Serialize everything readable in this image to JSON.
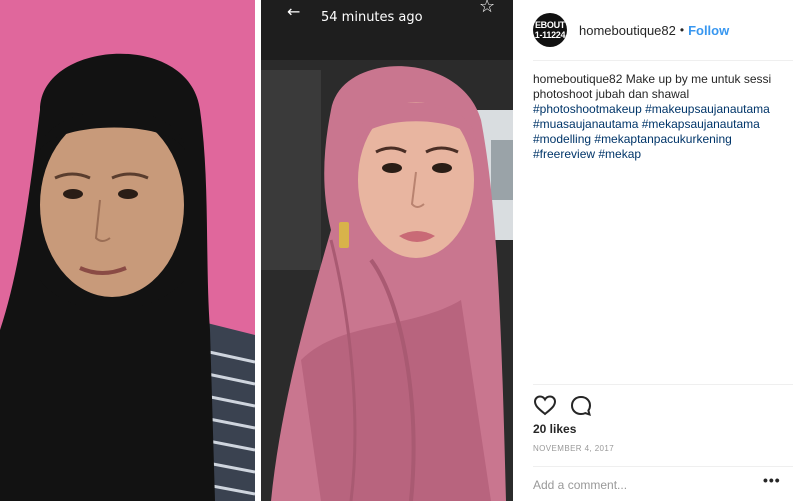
{
  "story": {
    "back_icon": "back-arrow-icon",
    "time": "54 minutes ago",
    "star_icon": "star-icon"
  },
  "post": {
    "avatar_text_line1": "EBOUT",
    "avatar_text_line2": "1-11224",
    "username": "homeboutique82",
    "dot": "•",
    "follow_label": "Follow",
    "caption_user": "homeboutique82",
    "caption_text": "Make up by me untuk sessi photoshoot jubah dan shawal",
    "hashtags": [
      "#photoshootmakeup",
      "#makeupsaujanautama",
      "#muasaujanautama",
      "#mekapsaujanautama",
      "#modelling",
      "#mekaptanpacukurkening",
      "#freereview",
      "#mekap"
    ],
    "likes": "20 likes",
    "date": "NOVEMBER 4, 2017",
    "comment_placeholder": "Add a comment...",
    "more_label": "•••"
  },
  "colors": {
    "left_background": "#e0679c",
    "hijab_black": "#121212",
    "hijab_pink": "#c9768f",
    "link": "#003569",
    "follow": "#3897f0"
  }
}
